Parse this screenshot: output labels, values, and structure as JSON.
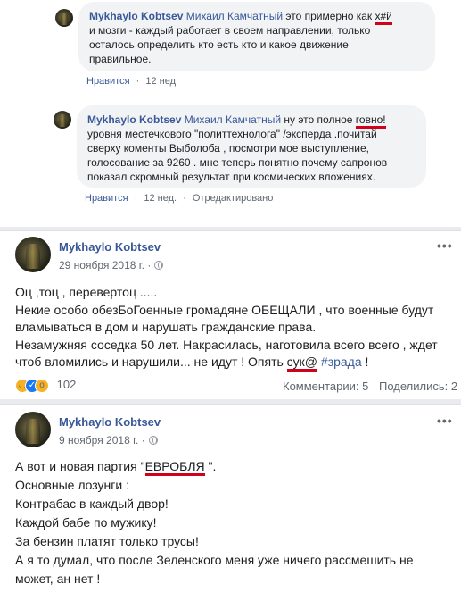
{
  "comments": [
    {
      "author": "Mykhaylo Kobtsev",
      "mention": "Михаил Камчатный",
      "line1_pre": " это примерно как ",
      "line1_ul": "х#й",
      "line2": "и мозги - каждый работает в своем направлении, только",
      "line3": "осталось определить кто есть кто и какое движение",
      "line4": "правильное.",
      "like": "Нравится",
      "dot": "·",
      "time": "12 нед."
    },
    {
      "author": "Mykhaylo Kobtsev",
      "mention": "Михаил Камчатный",
      "line1_pre": " ну это полное ",
      "line1_ul": "говно!",
      "line2": "уровня местечкового \"политтехнолога\" /эксперда .почитай",
      "line3": "сверху коменты Выболоба , посмотри мое выступление,",
      "line4": "голосование за 9260 . мне теперь понятно почему сапронов",
      "line5": "показал скромный результат при космических вложениях.",
      "like": "Нравится",
      "dot": "·",
      "time": "12 нед.",
      "edited": "Отредактировано"
    }
  ],
  "posts": [
    {
      "author": "Mykhaylo Kobtsev",
      "date": "29 ноября 2018 г. ·",
      "more": "•••",
      "lines": [
        "Оц ,тоц , перевертоц .....",
        "Некие особо обезБоГоенные громадяне ОБЕЩАЛИ , что военные будут",
        "вламываться в дом и нарушать гражданские права.",
        "Незамужняя соседка 50 лет. Накрасилась, наготовила всего всего , ждет",
        "чтоб вломились и нарушили... не идут ! Опять "
      ],
      "ul_word": "сук@",
      "hashtag": "#зрада",
      "end": " !",
      "reactions_count": "102",
      "comments_label": "Комментарии: 5",
      "shares_label": "Поделились: 2"
    },
    {
      "author": "Mykhaylo Kobtsev",
      "date": "9 ноября 2018 г. ·",
      "more": "•••",
      "line1_pre": "А вот и новая партия \"",
      "line1_ul": "ЕВРОБЛЯ",
      "line1_post": " \".",
      "lines": [
        "Основные лозунги :",
        "Контрабас в каждый двор!",
        "Каждой бабе по мужику!",
        "За бензин платят только трусы!",
        "А я то думал, что после Зеленского меня уже ничего рассмешить не",
        "может, ан нет !"
      ]
    }
  ]
}
